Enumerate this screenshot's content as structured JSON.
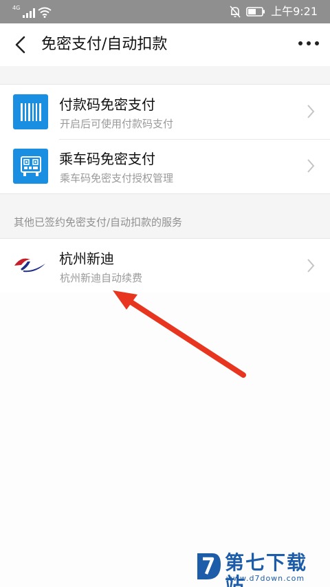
{
  "status_bar": {
    "network": "4G",
    "time": "上午9:21"
  },
  "header": {
    "title": "免密支付/自动扣款"
  },
  "main_services": [
    {
      "title": "付款码免密支付",
      "subtitle": "开启后可使用付款码支付",
      "icon": "barcode-icon"
    },
    {
      "title": "乘车码免密支付",
      "subtitle": "乘车码免密支付授权管理",
      "icon": "qr-code-icon"
    }
  ],
  "other_services": {
    "section_label": "其他已签约免密支付/自动扣款的服务",
    "items": [
      {
        "title": "杭州新迪",
        "subtitle": "杭州新迪自动续费",
        "icon": "hangzhou-xindi-logo"
      }
    ]
  },
  "watermark": {
    "text": "第七下载站",
    "url": "www.d7down.com"
  },
  "colors": {
    "accent_blue": "#1a8fe2",
    "annotation_arrow": "#e8351f",
    "status_bar": "#8f8f8f",
    "watermark": "#1c5ca8"
  }
}
